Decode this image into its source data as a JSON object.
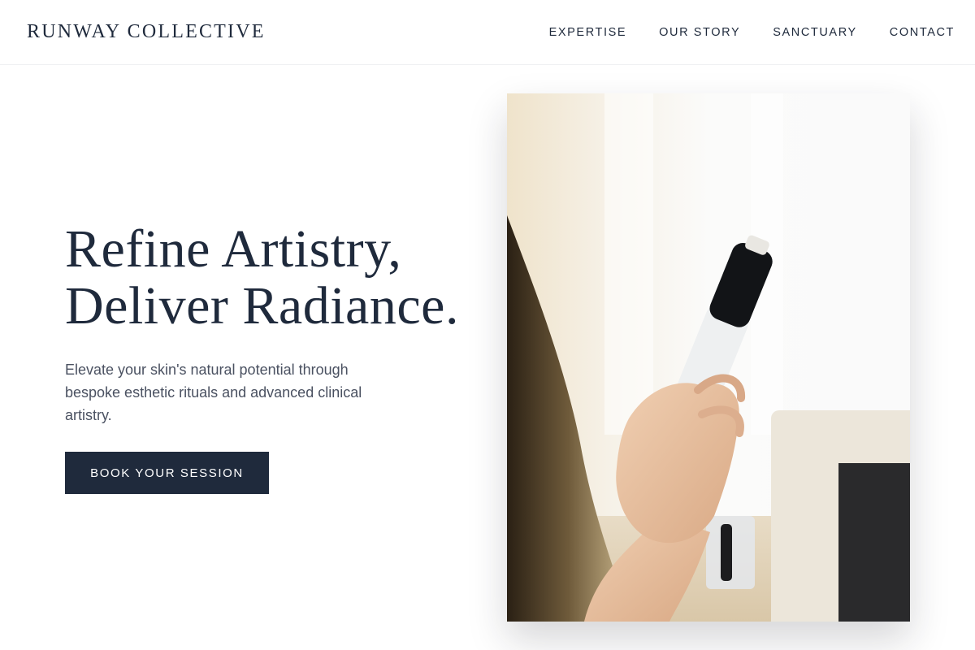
{
  "header": {
    "brand": "RUNWAY COLLECTIVE",
    "nav": [
      {
        "label": "EXPERTISE"
      },
      {
        "label": "OUR STORY"
      },
      {
        "label": "SANCTUARY"
      },
      {
        "label": "CONTACT"
      }
    ]
  },
  "hero": {
    "title_line1": "Refine Artistry,",
    "title_line2": "Deliver Radiance.",
    "subtitle": "Elevate your skin's natural potential through bespoke esthetic rituals and advanced clinical artistry.",
    "cta_label": "BOOK YOUR SESSION"
  },
  "colors": {
    "primary": "#1f2a3c",
    "text_muted": "#4a5161",
    "background": "#ffffff"
  }
}
